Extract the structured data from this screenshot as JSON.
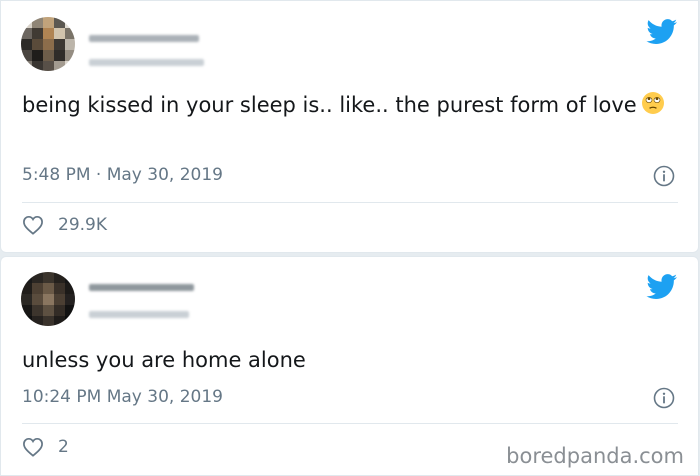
{
  "tweets": [
    {
      "text": "being kissed in your sleep is.. like.. the purest form of love",
      "emoji": "face-with-rolling-eyes-emoji",
      "timestamp": "5:48 PM · May 30, 2019",
      "likes": "29.9K"
    },
    {
      "text": "unless you are home alone",
      "timestamp": "10:24 PM May 30, 2019",
      "likes": "2"
    }
  ],
  "watermark": "boredpanda.com",
  "colors": {
    "twitter_blue": "#1da1f2",
    "text": "#14171a",
    "muted": "#657786",
    "divider": "#e1e8ed"
  },
  "icons": [
    "avatar",
    "twitter-bird-icon",
    "info-icon",
    "heart-icon"
  ]
}
